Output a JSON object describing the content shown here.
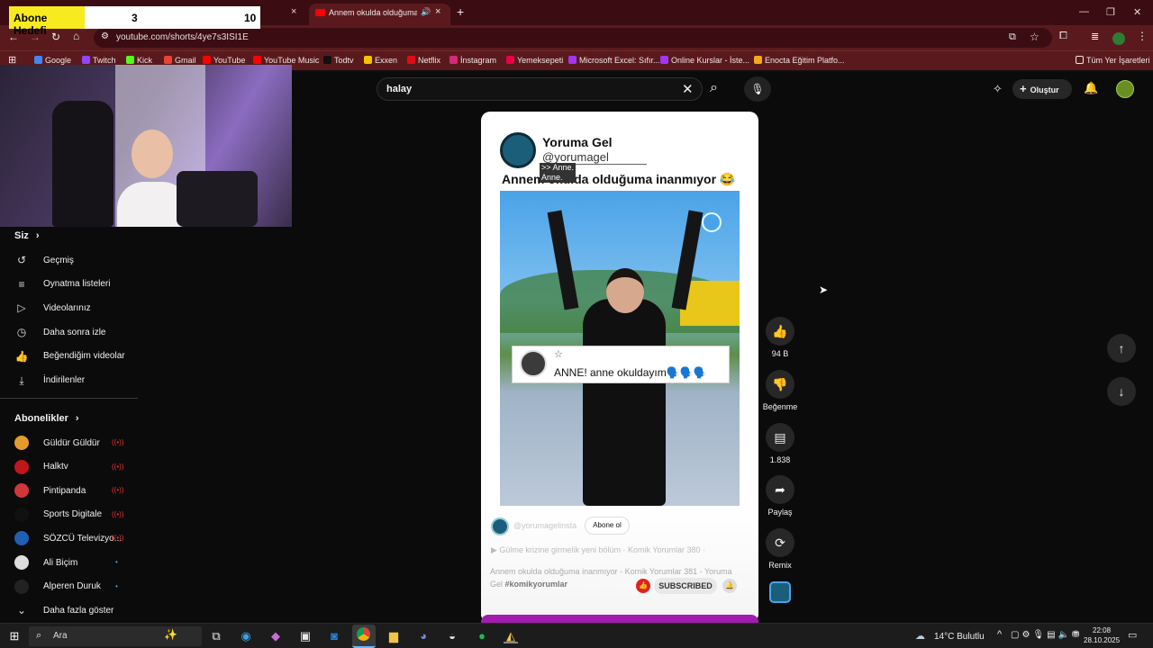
{
  "tabs": {
    "active_title": "Annem okulda olduğuma i",
    "close": "×",
    "new_tab": "+"
  },
  "window": {
    "minimize": "—",
    "maximize": "❐",
    "close": "✕"
  },
  "address": {
    "url": "youtube.com/shorts/4ye7s3ISI1E"
  },
  "bookmarks": {
    "items": [
      {
        "label": "Google",
        "color": "#4285f4"
      },
      {
        "label": "Twitch",
        "color": "#9146ff"
      },
      {
        "label": "Kick",
        "color": "#53fc18"
      },
      {
        "label": "Gmail",
        "color": "#ea4335"
      },
      {
        "label": "YouTube",
        "color": "#ff0000"
      },
      {
        "label": "YouTube Music",
        "color": "#ff0000"
      },
      {
        "label": "Todtv",
        "color": "#111111"
      },
      {
        "label": "Exxen",
        "color": "#f5c400"
      },
      {
        "label": "Netflix",
        "color": "#e50914"
      },
      {
        "label": "İnstagram",
        "color": "#d62976"
      },
      {
        "label": "Yemeksepeti",
        "color": "#ea004b"
      },
      {
        "label": "Microsoft Excel: Sıfır...",
        "color": "#a435f0"
      },
      {
        "label": "Online Kurslar - İste...",
        "color": "#a435f0"
      },
      {
        "label": "Enocta Eğitim Platfo...",
        "color": "#f7a81b"
      }
    ],
    "all": "Tüm Yer İşaretleri"
  },
  "overlay": {
    "label": "Abone Hedefi",
    "current": "3",
    "goal": "10"
  },
  "sidebar": {
    "you": "Siz",
    "items": [
      {
        "label": "Geçmiş",
        "icon": "history-icon",
        "glyph": "↺"
      },
      {
        "label": "Oynatma listeleri",
        "icon": "playlist-icon",
        "glyph": "≡"
      },
      {
        "label": "Videolarınız",
        "icon": "video-icon",
        "glyph": "▷"
      },
      {
        "label": "Daha sonra izle",
        "icon": "clock-icon",
        "glyph": "◷"
      },
      {
        "label": "Beğendiğim videolar",
        "icon": "thumb-up-icon",
        "glyph": "👍"
      },
      {
        "label": "İndirilenler",
        "icon": "download-icon",
        "glyph": "⤓"
      }
    ],
    "subs_title": "Abonelikler",
    "subs": [
      {
        "label": "Güldür Güldür",
        "color": "#e39b2b",
        "live": true
      },
      {
        "label": "Halktv",
        "color": "#c0161e",
        "live": true
      },
      {
        "label": "Pintipanda",
        "color": "#d0363a",
        "live": true
      },
      {
        "label": "Sports Digitale",
        "color": "#111111",
        "live": true
      },
      {
        "label": "SÖZCÜ Televizyo...",
        "color": "#1f5fb4",
        "live": true
      },
      {
        "label": "Ali Biçim",
        "color": "#dddddd",
        "live": false
      },
      {
        "label": "Alperen Duruk",
        "color": "#222222",
        "live": false
      }
    ],
    "more": "Daha fazla göster"
  },
  "search": {
    "query": "halay"
  },
  "header": {
    "create": "Oluştur"
  },
  "short": {
    "channel_name": "Yoruma Gel",
    "handle": "@yorumagel",
    "overlay_tag": ">> Anne.\nAnne.",
    "caption": "Annem okulda olduğuma inanmıyor 😂",
    "comment_text": "ANNE! anne okuldayım🗣️🗣️🗣️",
    "star": "☆",
    "insta_handle": "@yorumagelinsta",
    "subscribe_pill": "Abone ol",
    "playlist": "▶ Gülme krizine girmelik yeni bölüm · Komik Yorumlar 380 ·",
    "title_line1": "Annem okulda olduğuma inanmıyor - Komik Yorumlar 381 - Yoruma",
    "title_line2_pre": "Gel ",
    "hashtag": "#komikyorumlar",
    "subscribed": "SUBSCRIBED"
  },
  "actions": {
    "like_count": "94 B",
    "dislike_label": "Beğenme",
    "comments_count": "1.838",
    "share_label": "Paylaş",
    "remix_label": "Remix"
  },
  "taskbar": {
    "search_placeholder": "Ara",
    "weather": "14°C Bulutlu",
    "time": "22:08",
    "date": "28.10.2025"
  },
  "colors": {
    "accent": "#ff0000",
    "chrome_frame": "#5a1a1d",
    "overlay_yellow": "#f7ea1f"
  }
}
